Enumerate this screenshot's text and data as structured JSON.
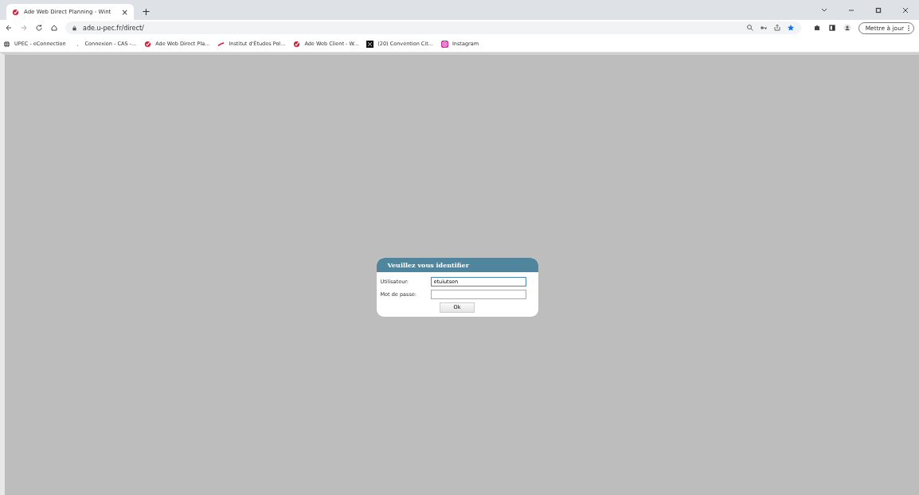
{
  "browser": {
    "tab": {
      "title": "Ade Web Direct Planning - Wint",
      "close": "×"
    },
    "new_tab": "+",
    "address": "ade.u-pec.fr/direct/",
    "update_button": "Mettre à jour",
    "bookmarks": [
      {
        "label": "UPEC - eConnection",
        "kind": "globe"
      },
      {
        "label": "Connexion - CAS -...",
        "kind": "dot"
      },
      {
        "label": "Ade Web Direct Pla...",
        "kind": "ade"
      },
      {
        "label": "Institut d'Études Pol...",
        "kind": "stroke"
      },
      {
        "label": "Ade Web Client - W...",
        "kind": "ade"
      },
      {
        "label": "(20) Convention Cit...",
        "kind": "x"
      },
      {
        "label": "Instagram",
        "kind": "insta"
      }
    ]
  },
  "login": {
    "title": "Veuillez vous identifier",
    "fields": [
      {
        "label": "Utilisateur:",
        "value": "etuiutsen",
        "focused": true
      },
      {
        "label": "Mot de passe:",
        "focused": false
      }
    ],
    "button": "Ok"
  }
}
